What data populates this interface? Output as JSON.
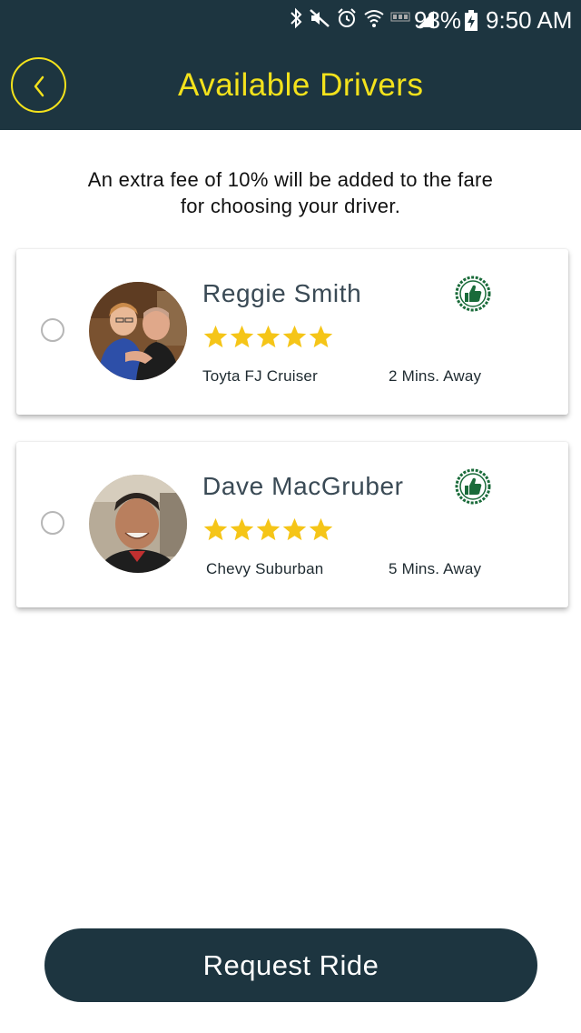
{
  "status_bar": {
    "battery_percent": "93%",
    "time": "9:50 AM",
    "icons": [
      "bluetooth-icon",
      "mute-icon",
      "alarm-icon",
      "wifi-icon",
      "lte-icon",
      "signal-icon",
      "battery-charging-icon"
    ]
  },
  "header": {
    "title": "Available Drivers",
    "back_icon": "chevron-left-icon"
  },
  "notice": {
    "line1": "An extra fee of 10% will be added to the fare",
    "line2": "for choosing your driver."
  },
  "drivers": [
    {
      "name": "Reggie Smith",
      "rating": 5,
      "max_rating": 5,
      "vehicle": "Toyta FJ Cruiser",
      "eta": "2 Mins. Away",
      "badge_icon": "thumbs-up-badge-icon",
      "selected": false
    },
    {
      "name": "Dave MacGruber",
      "rating": 5,
      "max_rating": 5,
      "vehicle": "Chevy Suburban",
      "eta": "5 Mins. Away",
      "badge_icon": "thumbs-up-badge-icon",
      "selected": false
    }
  ],
  "actions": {
    "request_label": "Request Ride"
  },
  "colors": {
    "header_bg": "#1d3540",
    "accent_yellow": "#f3e21c",
    "star_gold": "#f5c518",
    "badge_green": "#1a6b3a",
    "button_bg": "#1d3540"
  }
}
